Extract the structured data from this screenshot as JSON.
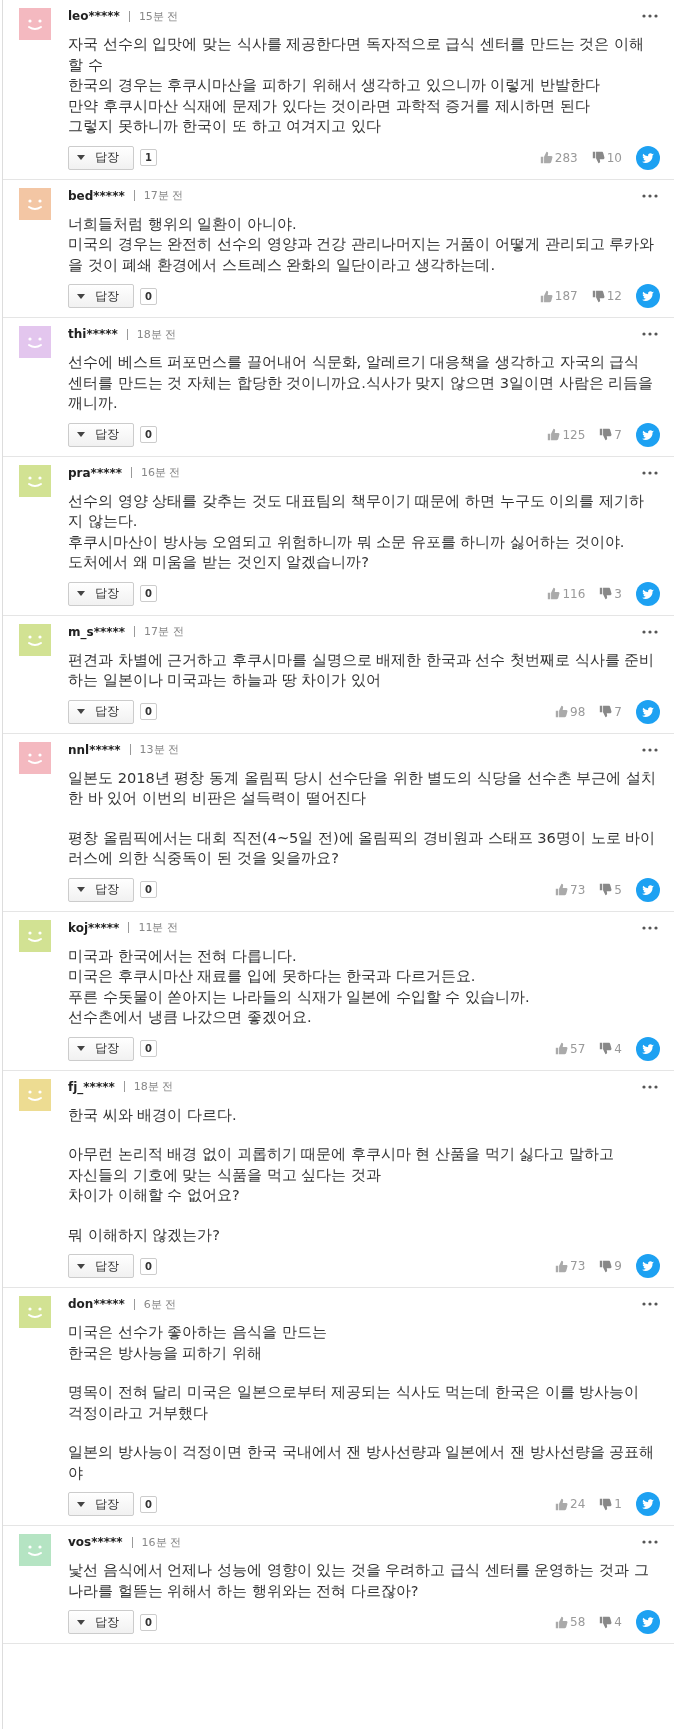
{
  "comments": [
    {
      "user": "leo*****",
      "time": "15분 전",
      "color": "#f4b9c0",
      "paragraphs": [
        [
          "자국 선수의 입맛에 맞는 식사를 제공한다면 독자적으로 급식 센터를 만드는 것은 이해할 수",
          "한국의 경우는 후쿠시마산을 피하기 위해서 생각하고 있으니까 이렇게 반발한다",
          "만약 후쿠시마산 식재에 문제가 있다는 것이라면 과학적 증거를 제시하면 된다",
          "그렇지 못하니까 한국이 또 하고 여겨지고 있다"
        ]
      ],
      "reply_label": "답장",
      "reply_count": "1",
      "likes": "283",
      "dislikes": "10"
    },
    {
      "user": "bed*****",
      "time": "17분 전",
      "color": "#f3c6a4",
      "paragraphs": [
        [
          "너희들처럼 행위의 일환이 아니야.",
          "미국의 경우는 완전히 선수의 영양과 건강 관리나머지는 거품이 어떻게 관리되고 루카와을 것이 폐쇄 환경에서 스트레스 완화의 일단이라고 생각하는데."
        ]
      ],
      "reply_label": "답장",
      "reply_count": "0",
      "likes": "187",
      "dislikes": "12"
    },
    {
      "user": "thi*****",
      "time": "18분 전",
      "color": "#e3c6ee",
      "paragraphs": [
        [
          "선수에 베스트 퍼포먼스를 끌어내어 식문화, 알레르기 대응책을 생각하고 자국의 급식 센터를 만드는 것 자체는 합당한 것이니까요.식사가 맞지 않으면 3일이면 사람은 리듬을 깨니까."
        ]
      ],
      "reply_label": "답장",
      "reply_count": "0",
      "likes": "125",
      "dislikes": "7"
    },
    {
      "user": "pra*****",
      "time": "16분 전",
      "color": "#d2e293",
      "paragraphs": [
        [
          "선수의 영양 상태를 갖추는 것도 대표팀의 책무이기 때문에 하면 누구도 이의를 제기하지 않는다.",
          "후쿠시마산이 방사능 오염되고 위험하니까 뭐 소문 유포를 하니까 싫어하는 것이야.",
          "도처에서 왜 미움을 받는 것인지 알겠습니까?"
        ]
      ],
      "reply_label": "답장",
      "reply_count": "0",
      "likes": "116",
      "dislikes": "3"
    },
    {
      "user": "m_s*****",
      "time": "17분 전",
      "color": "#d2e293",
      "paragraphs": [
        [
          "편견과 차별에 근거하고 후쿠시마를 실명으로 배제한 한국과 선수 첫번째로 식사를 준비하는 일본이나 미국과는 하늘과 땅 차이가 있어"
        ]
      ],
      "reply_label": "답장",
      "reply_count": "0",
      "likes": "98",
      "dislikes": "7"
    },
    {
      "user": "nnl*****",
      "time": "13분 전",
      "color": "#f4b9c0",
      "paragraphs": [
        [
          "일본도 2018년 평창 동계 올림픽 당시 선수단을 위한 별도의 식당을 선수촌 부근에 설치한 바 있어 이번의 비판은 설득력이 떨어진다"
        ],
        [
          "평창 올림픽에서는 대회 직전(4~5일 전)에 올림픽의 경비원과 스태프 36명이 노로 바이러스에 의한 식중독이 된 것을 잊을까요?"
        ]
      ],
      "reply_label": "답장",
      "reply_count": "0",
      "likes": "73",
      "dislikes": "5"
    },
    {
      "user": "koj*****",
      "time": "11분 전",
      "color": "#d2e293",
      "paragraphs": [
        [
          "미국과 한국에서는 전혀 다릅니다.",
          "미국은 후쿠시마산 재료를 입에 못하다는 한국과 다르거든요.",
          "푸른 수돗물이 쏟아지는 나라들의 식재가 일본에 수입할 수 있습니까.",
          "선수촌에서 냉큼 나갔으면 좋겠어요."
        ]
      ],
      "reply_label": "답장",
      "reply_count": "0",
      "likes": "57",
      "dislikes": "4"
    },
    {
      "user": "fj_*****",
      "time": "18분 전",
      "color": "#eddc92",
      "paragraphs": [
        [
          "한국 씨와 배경이 다르다."
        ],
        [
          "아무런 논리적 배경 없이 괴롭히기 때문에 후쿠시마 현 산품을 먹기 싫다고 말하고",
          "자신들의 기호에 맞는 식품을 먹고 싶다는 것과",
          "차이가 이해할 수 없어요?"
        ],
        [
          "뭐 이해하지 않겠는가?"
        ]
      ],
      "reply_label": "답장",
      "reply_count": "0",
      "likes": "73",
      "dislikes": "9"
    },
    {
      "user": "don*****",
      "time": "6분 전",
      "color": "#d2e293",
      "paragraphs": [
        [
          "미국은 선수가 좋아하는 음식을 만드는",
          "한국은 방사능을 피하기 위해"
        ],
        [
          "명목이 전혀 달리 미국은 일본으로부터 제공되는 식사도 먹는데 한국은 이를 방사능이 걱정이라고 거부했다"
        ],
        [
          "일본의 방사능이 걱정이면 한국 국내에서 잰 방사선량과 일본에서 잰 방사선량을 공표해야"
        ]
      ],
      "reply_label": "답장",
      "reply_count": "0",
      "likes": "24",
      "dislikes": "1"
    },
    {
      "user": "vos*****",
      "time": "16분 전",
      "color": "#b5e4c3",
      "paragraphs": [
        [
          "낯선 음식에서 언제나 성능에 영향이 있는 것을 우려하고 급식 센터를 운영하는 것과 그 나라를 헐뜯는 위해서 하는 행위와는 전혀 다르잖아?"
        ]
      ],
      "reply_label": "답장",
      "reply_count": "0",
      "likes": "58",
      "dislikes": "4"
    }
  ]
}
